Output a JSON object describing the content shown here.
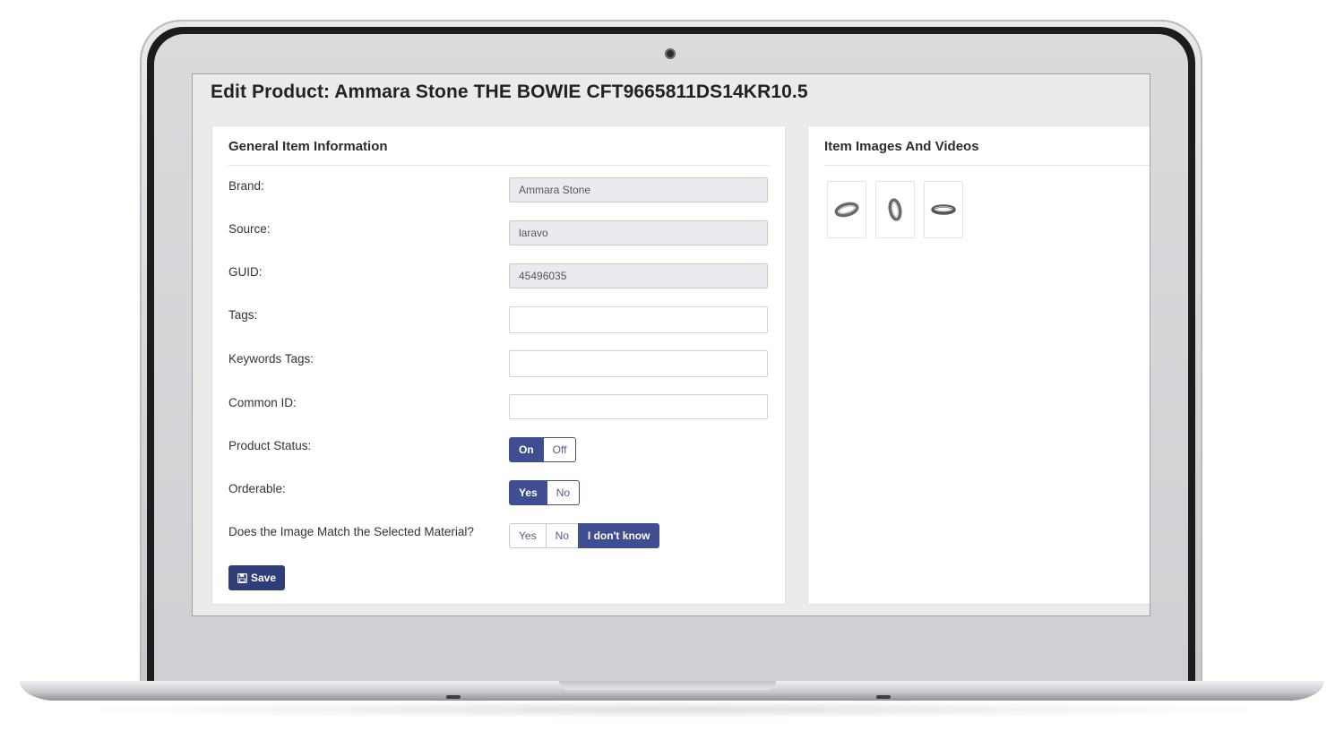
{
  "page": {
    "title": "Edit Product: Ammara Stone THE BOWIE CFT9665811DS14KR10.5"
  },
  "general": {
    "header": "General Item Information",
    "brand": {
      "label": "Brand:",
      "value": "Ammara Stone"
    },
    "source": {
      "label": "Source:",
      "value": "laravo"
    },
    "guid": {
      "label": "GUID:",
      "value": "45496035"
    },
    "tags": {
      "label": "Tags:",
      "value": ""
    },
    "keywords_tags": {
      "label": "Keywords Tags:",
      "value": ""
    },
    "common_id": {
      "label": "Common ID:",
      "value": ""
    },
    "product_status": {
      "label": "Product Status:",
      "options": [
        "On",
        "Off"
      ],
      "selected": "On"
    },
    "orderable": {
      "label": "Orderable:",
      "options": [
        "Yes",
        "No"
      ],
      "selected": "Yes"
    },
    "image_match": {
      "label": "Does the Image Match the Selected Material?",
      "options": [
        "Yes",
        "No",
        "I don't know"
      ],
      "selected": "I don't know"
    },
    "save_label": "Save"
  },
  "media": {
    "header": "Item Images And Videos",
    "thumbnails": [
      "ring-side-view",
      "ring-upright-view",
      "ring-flat-view"
    ]
  },
  "colors": {
    "accent": "#3f4e91",
    "save_button": "#2f3e7a",
    "readonly_field": "#e9ebee"
  }
}
